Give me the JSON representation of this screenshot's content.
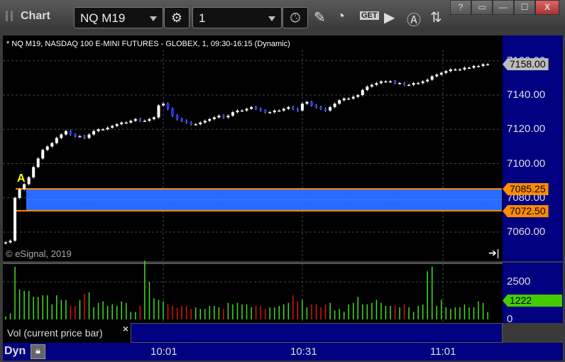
{
  "window": {
    "title": "Chart",
    "buttons": [
      "?",
      "▭",
      "—",
      "☐",
      "X"
    ]
  },
  "toolbar": {
    "symbol": "NQ M19",
    "interval": "1"
  },
  "chart": {
    "header": "* NQ M19, NASDAQ 100 E-MINI FUTURES - GLOBEX, 1, 09:30-16:15 (Dynamic)",
    "copyright": "© eSignal, 2019",
    "price_labels": [
      "7160.00",
      "7140.00",
      "7120.00",
      "7100.00",
      "7080.00",
      "7060.00"
    ],
    "last_price": "7158.00",
    "band_upper": "7085.25",
    "band_lower": "7072.50",
    "marker": "A",
    "colors": {
      "up": "#ffffff",
      "down": "#2030ff",
      "vol_up": "#44dd22",
      "vol_down": "#dd1111",
      "band": "#2a6bff",
      "band_line": "#ff8c00"
    }
  },
  "volume": {
    "labels": [
      "2500",
      "0"
    ],
    "current": "1222",
    "legend": "Vol (current price bar)",
    "close_icon": "×"
  },
  "time_axis": {
    "labels": [
      "10:01",
      "10:31",
      "11:01"
    ],
    "mode": "Dyn"
  },
  "chart_data": {
    "type": "candlestick",
    "ylim": [
      7050,
      7170
    ],
    "close": [
      7054,
      7055,
      7080,
      7085,
      7088,
      7092,
      7098,
      7103,
      7108,
      7110,
      7112,
      7115,
      7117,
      7119,
      7117,
      7116,
      7116,
      7115,
      7117,
      7119,
      7120,
      7120,
      7121,
      7122,
      7123,
      7124,
      7124,
      7125,
      7126,
      7125,
      7125,
      7126,
      7127,
      7134,
      7135,
      7132,
      7128,
      7126,
      7125,
      7124,
      7123,
      7123,
      7124,
      7125,
      7126,
      7127,
      7128,
      7127,
      7128,
      7130,
      7131,
      7131,
      7132,
      7133,
      7132,
      7131,
      7130,
      7130,
      7131,
      7131,
      7132,
      7133,
      7132,
      7131,
      7135,
      7136,
      7134,
      7133,
      7132,
      7131,
      7133,
      7135,
      7137,
      7138,
      7138,
      7139,
      7140,
      7143,
      7145,
      7146,
      7147,
      7148,
      7148,
      7148,
      7147,
      7147,
      7146,
      7146,
      7147,
      7147,
      7148,
      7149,
      7151,
      7152,
      7153,
      7154,
      7155,
      7155,
      7155,
      7156,
      7156,
      7157,
      7157,
      7158,
      7158
    ],
    "volume": [
      200,
      400,
      3500,
      2000,
      1900,
      1900,
      1500,
      1500,
      1600,
      1600,
      1000,
      1600,
      1300,
      1300,
      900,
      900,
      1300,
      1700,
      1800,
      800,
      1100,
      1200,
      900,
      1000,
      900,
      1200,
      1100,
      500,
      500,
      900,
      3900,
      2500,
      1400,
      1300,
      1200,
      1000,
      900,
      800,
      900,
      900,
      700,
      800,
      700,
      700,
      900,
      900,
      800,
      700,
      1100,
      1000,
      1100,
      1000,
      1000,
      800,
      900,
      900,
      700,
      800,
      800,
      900,
      1000,
      1100,
      1600,
      1200,
      1300,
      800,
      1000,
      1000,
      800,
      1000,
      1100,
      600,
      700,
      500,
      1000,
      1100,
      1500,
      1000,
      1000,
      1100,
      1300,
      1100,
      900,
      900,
      900,
      800,
      1000,
      800,
      500,
      900,
      1000,
      3200,
      3500,
      900,
      1300,
      800,
      700,
      800,
      800,
      1000,
      800,
      800,
      1200,
      1100,
      500,
      1000,
      1222
    ],
    "xlabels": [
      "10:01",
      "10:31",
      "11:01"
    ],
    "vol_ylim": [
      0,
      2500
    ]
  }
}
